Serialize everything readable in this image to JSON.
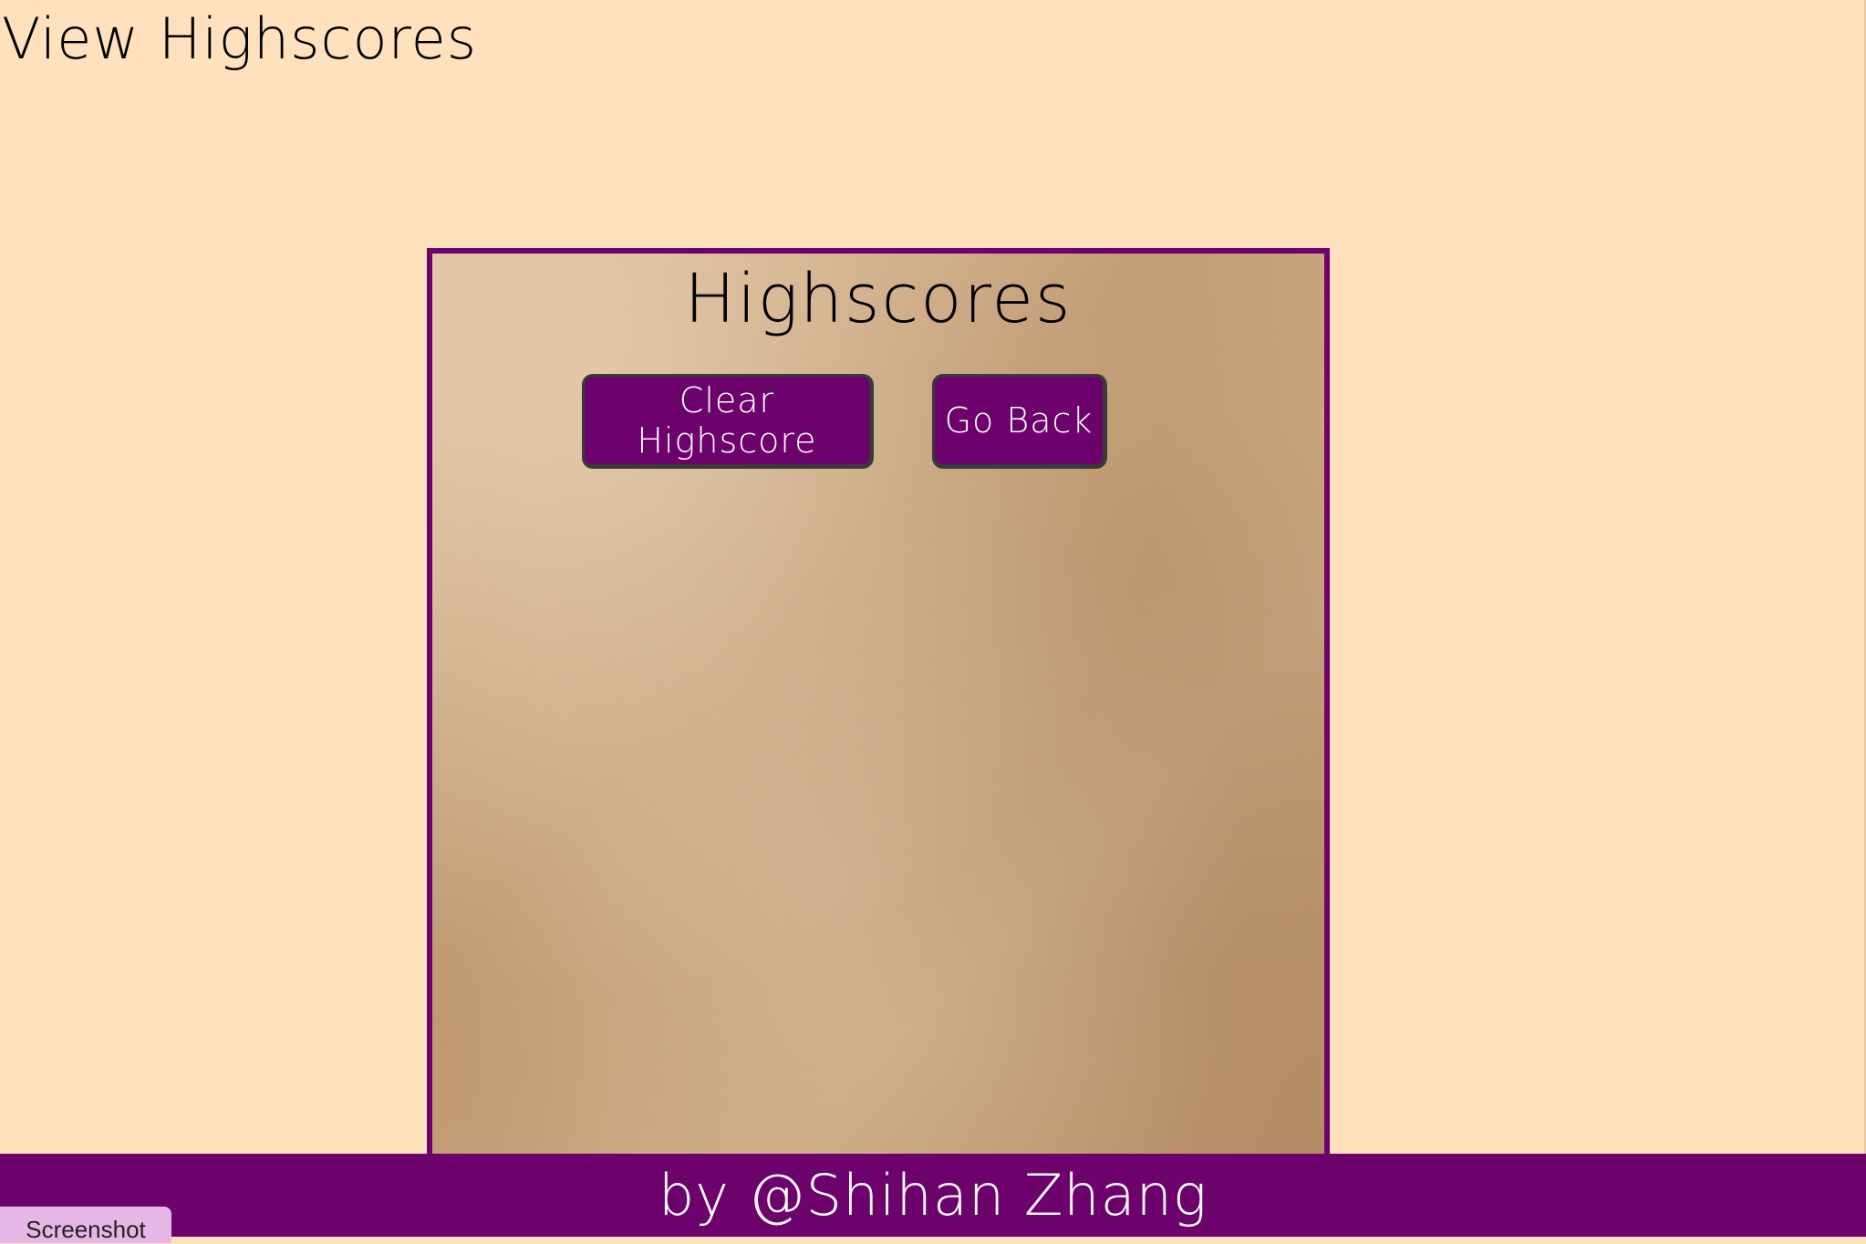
{
  "nav": {
    "view_highscores": "View Highscores"
  },
  "panel": {
    "title": "Highscores",
    "clear_button": "Clear Highscore",
    "back_button": "Go Back",
    "scores": []
  },
  "footer": {
    "text": "by @Shihan Zhang"
  },
  "overlay": {
    "screenshot_label": "Screenshot"
  },
  "colors": {
    "background": "#ffe2bd",
    "accent": "#6d026d",
    "button_text": "#ffffff"
  }
}
